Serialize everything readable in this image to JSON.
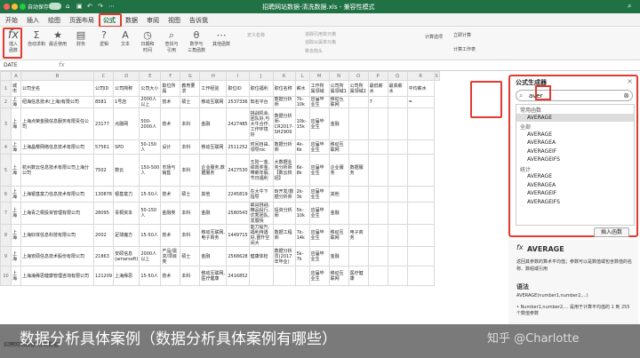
{
  "titlebar": {
    "autosave": "自动保存",
    "toggle": "关闭",
    "document": "招聘网站数据-清洗数据.xls  -  兼容性模式"
  },
  "tabs": [
    "开始",
    "插入",
    "绘图",
    "页面布局",
    "公式",
    "数据",
    "审阅",
    "视图",
    "告诉我"
  ],
  "ribbon": {
    "insert_function": "插入\n函数",
    "groups": [
      "自动求和",
      "最近使用",
      "财务",
      "逻辑",
      "文本",
      "日期和\n时间",
      "查找与\n引用",
      "数学与\n三角函数",
      "其他函数"
    ],
    "define_name": "定义名称",
    "trace_precedents": "追踪引用单元格",
    "trace_dependents": "追踪从属单元格",
    "remove_arrows": "移去箭头",
    "calc_options": "计算选项",
    "calc_now": "立即计算",
    "calc_sheet": "计算工作表"
  },
  "formula_bar": {
    "name_box": "DATE",
    "fx": "fx"
  },
  "grid": {
    "columns": [
      "",
      "A",
      "B",
      "C",
      "D",
      "E",
      "F",
      "G",
      "H",
      "I",
      "J",
      "K",
      "L",
      "M",
      "N",
      "O",
      "P",
      "Q",
      "R",
      "S"
    ],
    "rows": [
      {
        "n": "1",
        "cells": [
          "城市",
          "公司全名",
          "公司ID",
          "公司简称",
          "公司大小",
          "职位所属",
          "教育要求",
          "工作经验",
          "职位ID",
          "职位福利",
          "职位名称",
          "薪水",
          "工作所属领域",
          "公司所属领域1",
          "公司所属领域2",
          "最低薪水",
          "最高薪水",
          "平均薪水"
        ]
      },
      {
        "n": "2",
        "cells": [
          "上海",
          "纽海信息技术(上海)有限公司",
          "8581",
          "1号店",
          "2000人以上",
          "技术",
          "硕士",
          "移动互联网",
          "2537336",
          "知名平台",
          "数据分析师",
          "7k-10k",
          "应届毕业生",
          "移动互联网",
          "",
          "7",
          "",
          "="
        ]
      },
      {
        "n": "3",
        "cells": [
          "上海",
          "上海点荣金融信息服务有限责任公司",
          "23177",
          "点融网",
          "500-2000人",
          "技术",
          "本科",
          "金融",
          "2427485",
          "挑战机会,团队好,与大牛合作,工作环境好",
          "数据分析师-CR2017-SH2909",
          "10k-15k",
          "应届毕业生",
          "金融",
          "",
          "",
          "",
          ""
        ]
      },
      {
        "n": "4",
        "cells": [
          "上海",
          "上海晶樱网络信息技术有限公司",
          "57561",
          "SPD",
          "50-150人",
          "设计",
          "本科",
          "移动互联网",
          "2511252",
          "时间自由,领导nic",
          "数据分析师",
          "4k-6k",
          "应届毕业生",
          "移动互联网",
          "",
          "",
          "",
          ""
        ]
      },
      {
        "n": "5",
        "cells": [
          "上海",
          "杭州数云信息技术有限公司上海分公司",
          "7502",
          "数云",
          "150-500人",
          "市场与销售",
          "本科",
          "企业服务,数据服务",
          "2427530",
          "五险一金,绩效奖金,带薪年假,节日福利",
          "大数据业务分析师【数云校招】",
          "6k-8k",
          "应届毕业生",
          "企业服务",
          "数据服务",
          "",
          "",
          ""
        ]
      },
      {
        "n": "6",
        "cells": [
          "上海",
          "上海银基富力信息技术有限公司",
          "130876",
          "银基富力",
          "15-50人",
          "技术",
          "硕士",
          "其他",
          "2245819",
          "在大牛下指导",
          "BI开发/数据分析师",
          "2k-3k",
          "应届毕业生",
          "其他",
          "",
          "",
          "",
          ""
        ]
      },
      {
        "n": "7",
        "cells": [
          "上海",
          "上海青之桐投资管理有限公司",
          "28095",
          "青桐资本",
          "50-150人",
          "金融类",
          "本科",
          "金融",
          "2580543",
          "最具挑战,精品投行,优秀团队,发展快",
          "投资分析师",
          "5k-10k",
          "应届毕业生",
          "金融",
          "",
          "",
          "",
          ""
        ]
      },
      {
        "n": "8",
        "cells": [
          "上海",
          "上海好体信息科技有限公司",
          "2002",
          "足球魔方",
          "15-50人",
          "技术",
          "本科",
          "移动互联网,电子商务",
          "1449715",
          "能力提升,福利待遇好,晋升空间大",
          "数据工程师",
          "7k-14k",
          "应届毕业生",
          "移动互联网",
          "电子商务",
          "",
          "",
          ""
        ]
      },
      {
        "n": "9",
        "cells": [
          "上海",
          "上海安硕信息技术股份有限公司",
          "21863",
          "安硕信息(amarsoft)",
          "2000人以上",
          "产品/需求/项目类",
          "硕士",
          "金融",
          "2568628",
          "健康体检",
          "数据分析员(2017年毕业)",
          "5k-7k",
          "应届毕业生",
          "金融",
          "",
          "",
          "",
          ""
        ]
      },
      {
        "n": "10",
        "cells": [
          "上海",
          "上海海舜思健康管理咨询有限公司",
          "121209",
          "上海舜思",
          "15-50人",
          "技术",
          "本科",
          "移动互联网,医疗健康",
          "2416852",
          "",
          "",
          "",
          "应届毕业生",
          "移动互联网",
          "医疗健康",
          "",
          "",
          ""
        ]
      }
    ]
  },
  "pane": {
    "title": "公式生成器",
    "search_value": "aver",
    "recent_header": "常用函数",
    "recent": [
      "AVERAGE"
    ],
    "all_header": "全部",
    "all": [
      "AVERAGE",
      "AVERAGEA",
      "AVERAGEIF",
      "AVERAGEIFS"
    ],
    "stat_header": "统计",
    "stat": [
      "AVERAGE",
      "AVERAGEA",
      "AVERAGEIF",
      "AVERAGEIFS"
    ],
    "insert_button": "插入函数"
  },
  "desc": {
    "fx": "fx",
    "name": "AVERAGE",
    "body": "返回其参数的算术平均值；参数可以是数值或包含数值的名称、数组或引用",
    "syntax_header": "语法",
    "syntax": "AVERAGE(number1,number2,...)",
    "args": "• Number1,number2,... 是用于计算平均值的 1 到 255 个数值参数"
  },
  "caption": "数据分析具体案例（数据分析具体案例有哪些）",
  "watermark": "知乎 @Charlotte",
  "sheet_tab": "招聘网站数据-清洗数据"
}
